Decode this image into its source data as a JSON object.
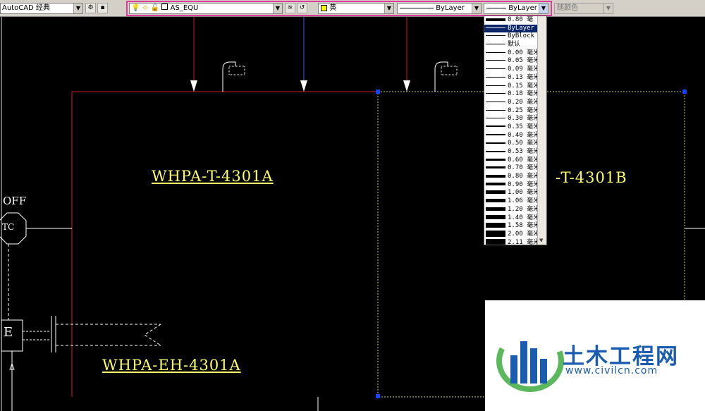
{
  "toolbar": {
    "workspace": "AutoCAD 经典",
    "layer": "AS_EQU",
    "color": "黄",
    "linetype": "ByLayer",
    "lineweight": "ByLayer",
    "plotstyle": "随颜色"
  },
  "drawing": {
    "label_a": "WHPA-T-4301A",
    "label_b": "-T-4301B",
    "label_eh": "WHPA-EH-4301A",
    "off": "OFF",
    "tc": "TC",
    "e": "E"
  },
  "lineweight_list": [
    {
      "label": "0.80 毫"
    },
    {
      "label": "ByLayer",
      "selected": true
    },
    {
      "label": "ByBlock"
    },
    {
      "label": "默认"
    },
    {
      "label": "0.00 毫米"
    },
    {
      "label": "0.05 毫米"
    },
    {
      "label": "0.09 毫米"
    },
    {
      "label": "0.13 毫米"
    },
    {
      "label": "0.15 毫米"
    },
    {
      "label": "0.18 毫米"
    },
    {
      "label": "0.20 毫米"
    },
    {
      "label": "0.25 毫米"
    },
    {
      "label": "0.30 毫米"
    },
    {
      "label": "0.35 毫米"
    },
    {
      "label": "0.40 毫米"
    },
    {
      "label": "0.50 毫米"
    },
    {
      "label": "0.53 毫米"
    },
    {
      "label": "0.60 毫米"
    },
    {
      "label": "0.70 毫米"
    },
    {
      "label": "0.80 毫米"
    },
    {
      "label": "0.90 毫米"
    },
    {
      "label": "1.00 毫米"
    },
    {
      "label": "1.06 毫米"
    },
    {
      "label": "1.20 毫米"
    },
    {
      "label": "1.40 毫米"
    },
    {
      "label": "1.58 毫米"
    },
    {
      "label": "2.00 毫米"
    },
    {
      "label": "2.11 毫米"
    }
  ],
  "watermark": {
    "title": "土木工程网",
    "url": "www.civilcn.com"
  },
  "colors": {
    "toolbar_bg": "#d4d0c8",
    "highlight": "#e23c9a",
    "cad_yellow": "#ffff66",
    "cad_red": "#cc2222",
    "brand_blue": "#1a5db0"
  }
}
